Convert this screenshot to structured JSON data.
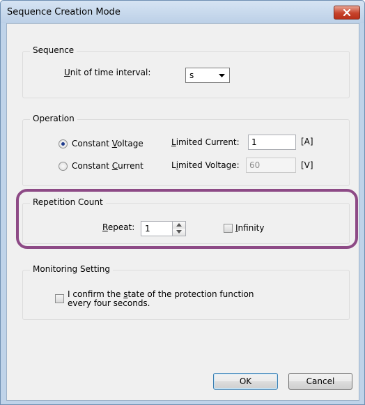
{
  "window": {
    "title": "Sequence Creation Mode"
  },
  "sequence": {
    "legend": "Sequence",
    "unit_label_u": "U",
    "unit_label_rest": "nit of time interval:",
    "unit_value": "s"
  },
  "operation": {
    "legend": "Operation",
    "cv_label_pre": "Constant ",
    "cv_label_u": "V",
    "cv_label_post": "oltage",
    "cc_label_pre": "Constant ",
    "cc_label_u": "C",
    "cc_label_post": "urrent",
    "selected": "Constant Voltage",
    "limited_current_u": "L",
    "limited_current_rest": "imited Current:",
    "limited_current_value": "1",
    "limited_current_unit": "[A]",
    "limited_voltage_pre": "L",
    "limited_voltage_u": "i",
    "limited_voltage_rest": "mited Voltage:",
    "limited_voltage_value": "60",
    "limited_voltage_unit": "[V]"
  },
  "repetition": {
    "legend": "Repetition Count",
    "repeat_u": "R",
    "repeat_rest": "epeat:",
    "repeat_value": "1",
    "infinity_u": "I",
    "infinity_rest": "nfinity",
    "infinity_checked": false
  },
  "monitoring": {
    "legend": "Monitoring Setting",
    "confirm_line1_pre": "I confirm the ",
    "confirm_line1_u": "s",
    "confirm_line1_post": "tate of the protection function",
    "confirm_line2": "every four seconds.",
    "confirm_checked": false
  },
  "buttons": {
    "ok": "OK",
    "cancel": "Cancel"
  },
  "colors": {
    "highlight": "#8d4a86",
    "title_bar": "#bfd3e9",
    "close": "#c7432b"
  }
}
